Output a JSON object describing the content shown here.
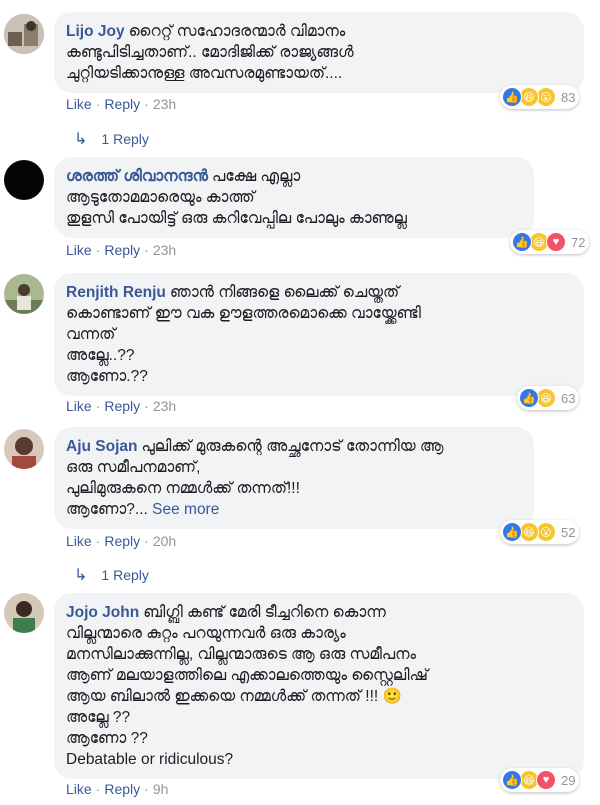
{
  "comments": [
    {
      "name": "Lijo Joy",
      "lines": [
        "റൈറ്റ് സഹോദരന്മാർ വിമാനം",
        "കണ്ടുപിടിച്ചതാണ്.. മോദിജിക്ക് രാജ്യങ്ങൾ",
        "ചുറ്റിയടിക്കാനുള്ള അവസരമുണ്ടായത്...."
      ],
      "like": "Like",
      "reply": "Reply",
      "time": "23h",
      "reactions": [
        "like",
        "haha",
        "wow"
      ],
      "count": "83",
      "avatar_colors": [
        "#8a7d6b",
        "#c9c2b6"
      ]
    },
    {
      "name": "ശരത്ത് ശിവാനന്ദൻ",
      "lines": [
        "പക്ഷേ എല്ലാ",
        "ആടുതോമമാരെയും കാത്ത്",
        "തുളസി പോയിട്ട് ഒരു കറിവേപ്പില പോലും കാണുല്ല"
      ],
      "like": "Like",
      "reply": "Reply",
      "time": "23h",
      "reactions": [
        "like",
        "haha",
        "love"
      ],
      "count": "72",
      "avatar_colors": [
        "#050505",
        "#151515"
      ]
    },
    {
      "name": "Renjith Renju",
      "lines": [
        "ഞാൻ നിങ്ങളെ ലൈക്ക് ചെയ്തത്",
        "കൊണ്ടാണ് ഈ വക ഊളത്തരമൊക്കെ വായ്ക്കേണ്ടി",
        "വന്നത്",
        "അല്ലേ..??",
        "ആണോ.??"
      ],
      "like": "Like",
      "reply": "Reply",
      "time": "23h",
      "reactions": [
        "like",
        "haha"
      ],
      "count": "63",
      "avatar_colors": [
        "#6b7d55",
        "#a9b88f"
      ]
    },
    {
      "name": "Aju Sojan",
      "lines": [
        "പുലിക്ക് മുരുകന്റെ അച്ഛനോട് തോന്നിയ ആ",
        "ഒരു സമീപനമാണ്,",
        "പുലിമുരുകനെ നമ്മൾക്ക് തന്നത്!!!",
        "ആണോ?..."
      ],
      "see_more": "See more",
      "like": "Like",
      "reply": "Reply",
      "time": "20h",
      "reactions": [
        "like",
        "haha",
        "wow"
      ],
      "count": "52",
      "avatar_colors": [
        "#a24a3c",
        "#d8c7bd"
      ]
    },
    {
      "name": "Jojo John",
      "lines": [
        "ബിഗ്ബി കണ്ട് മേരി ടീച്ചറിനെ കൊന്ന",
        "വില്ലന്മാരെ കുറ്റം പറയുന്നവർ ഒരു കാര്യം",
        "മനസിലാക്കുന്നില്ല, വില്ലന്മാരുടെ ആ ഒരു സമീപനം",
        "ആണ് മലയാളത്തിലെ എക്കാലത്തെയും സ്റ്റൈലിഷ്",
        "ആയ ബിലാൽ ഇക്കയെ നമ്മൾക്ക് തന്നത് !!! 🙂",
        "അല്ലേ ??",
        "ആണോ ??",
        "Debatable or ridiculous?"
      ],
      "like": "Like",
      "reply": "Reply",
      "time": "9h",
      "reactions": [
        "like",
        "haha",
        "love"
      ],
      "count": "29",
      "avatar_colors": [
        "#3f7e4c",
        "#d4c9b8"
      ]
    }
  ],
  "reply_threads": [
    "1 Reply",
    "1 Reply"
  ],
  "colors": {
    "link": "#385898",
    "bubble": "#f2f3f5",
    "like": "#3578e5",
    "haha": "#f7c62e",
    "love": "#f25268"
  }
}
